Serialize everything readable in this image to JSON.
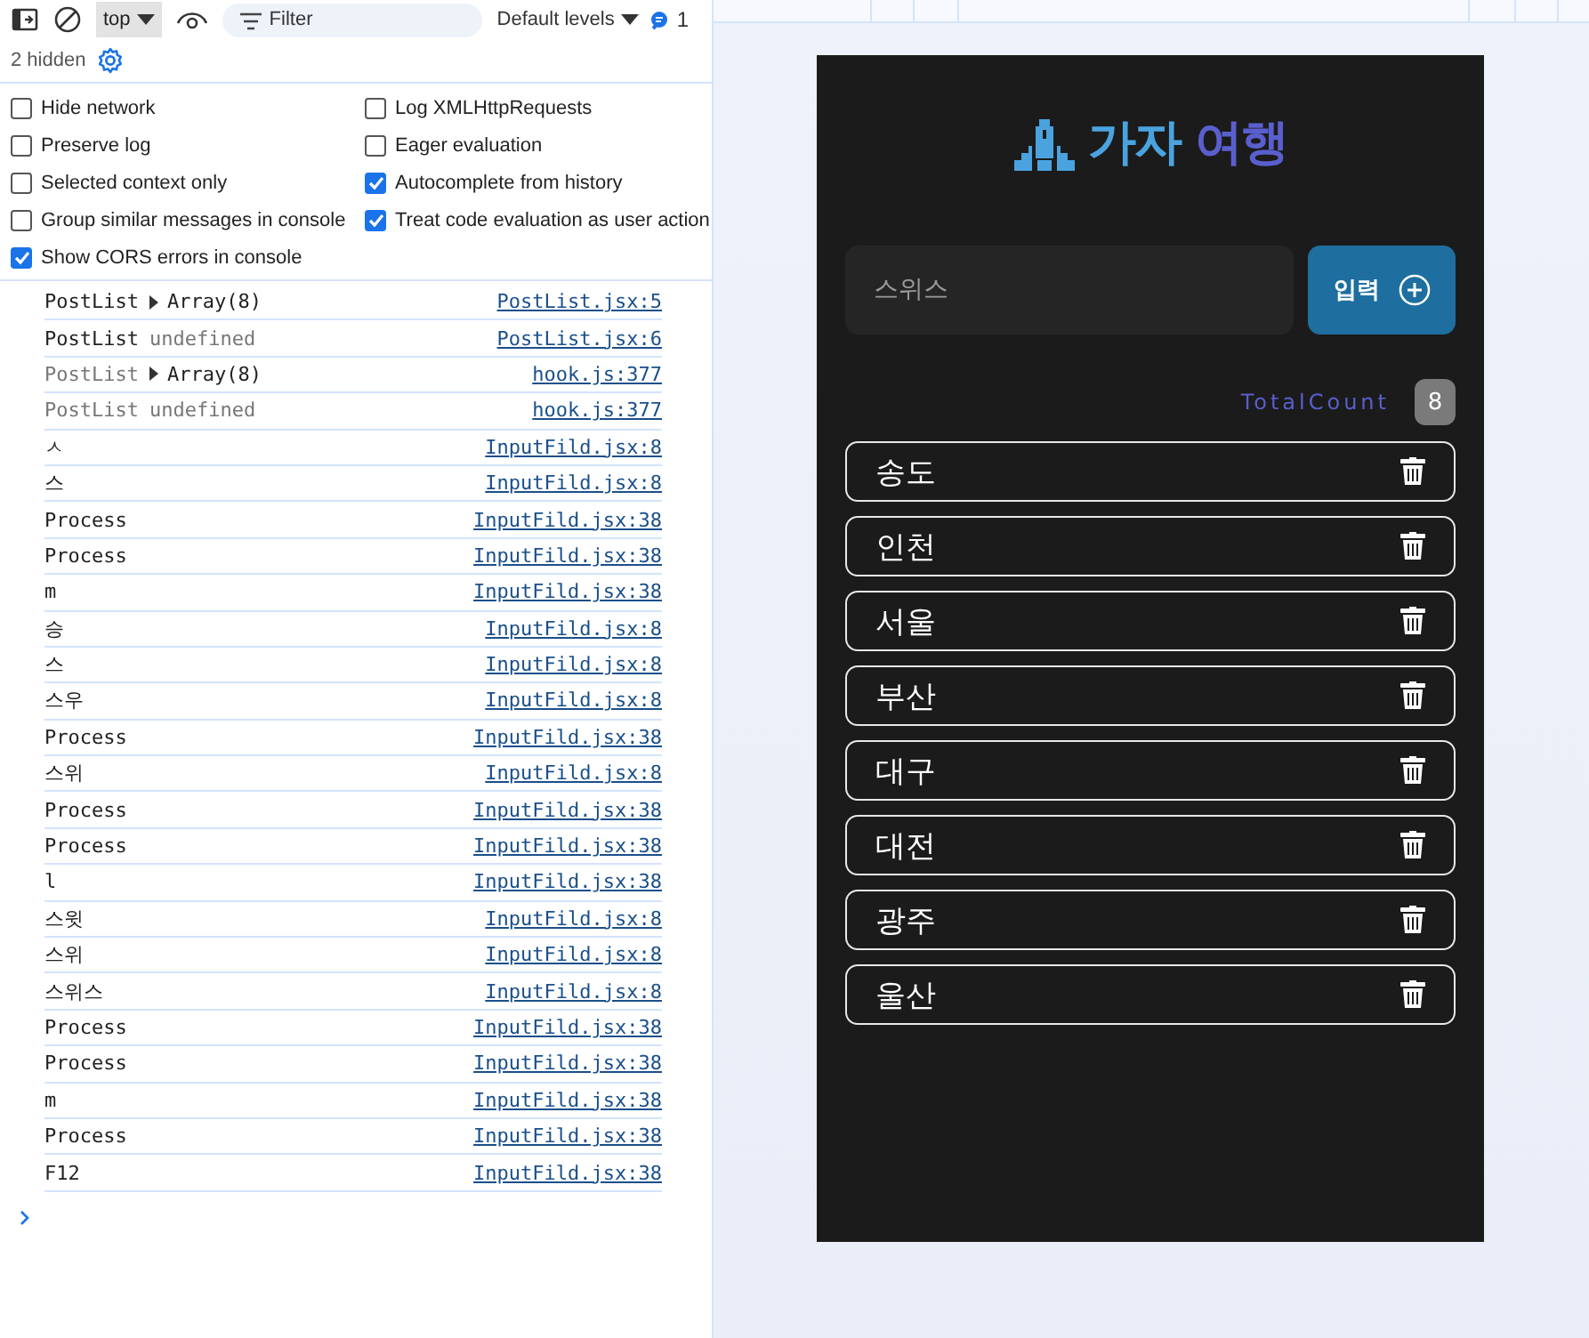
{
  "toolbar": {
    "context": "top",
    "filter_placeholder": "Filter",
    "levels": "Default levels",
    "issues_count": "1",
    "hidden": "2 hidden"
  },
  "settings": [
    {
      "label": "Hide network",
      "checked": false
    },
    {
      "label": "Log XMLHttpRequests",
      "checked": false
    },
    {
      "label": "Preserve log",
      "checked": false
    },
    {
      "label": "Eager evaluation",
      "checked": false
    },
    {
      "label": "Selected context only",
      "checked": false
    },
    {
      "label": "Autocomplete from history",
      "checked": true
    },
    {
      "label": "Group similar messages in console",
      "checked": false
    },
    {
      "label": "Treat code evaluation as user action",
      "checked": true
    },
    {
      "label": "Show CORS errors in console",
      "checked": true
    }
  ],
  "console": [
    {
      "text": "PostList",
      "value": {
        "kind": "object",
        "text": "Array(8)"
      },
      "dimmed": false,
      "source": "PostList.jsx:5"
    },
    {
      "text": "PostList",
      "value": {
        "kind": "undefined",
        "text": "undefined"
      },
      "dimmed": false,
      "source": "PostList.jsx:6"
    },
    {
      "text": "PostList",
      "value": {
        "kind": "object",
        "text": "Array(8)"
      },
      "dimmed": true,
      "source": "hook.js:377"
    },
    {
      "text": "PostList",
      "value": {
        "kind": "undefined",
        "text": "undefined"
      },
      "dimmed": true,
      "source": "hook.js:377"
    },
    {
      "text": "ㅅ",
      "dimmed": false,
      "source": "InputFild.jsx:8"
    },
    {
      "text": "스",
      "dimmed": false,
      "source": "InputFild.jsx:8"
    },
    {
      "text": "Process",
      "dimmed": false,
      "source": "InputFild.jsx:38"
    },
    {
      "text": "Process",
      "dimmed": false,
      "source": "InputFild.jsx:38"
    },
    {
      "text": "m",
      "dimmed": false,
      "source": "InputFild.jsx:38"
    },
    {
      "text": "승",
      "dimmed": false,
      "source": "InputFild.jsx:8"
    },
    {
      "text": "스",
      "dimmed": false,
      "source": "InputFild.jsx:8"
    },
    {
      "text": "스우",
      "dimmed": false,
      "source": "InputFild.jsx:8"
    },
    {
      "text": "Process",
      "dimmed": false,
      "source": "InputFild.jsx:38"
    },
    {
      "text": "스위",
      "dimmed": false,
      "source": "InputFild.jsx:8"
    },
    {
      "text": "Process",
      "dimmed": false,
      "source": "InputFild.jsx:38"
    },
    {
      "text": "Process",
      "dimmed": false,
      "source": "InputFild.jsx:38"
    },
    {
      "text": "l",
      "dimmed": false,
      "source": "InputFild.jsx:38"
    },
    {
      "text": "스윗",
      "dimmed": false,
      "source": "InputFild.jsx:8"
    },
    {
      "text": "스위",
      "dimmed": false,
      "source": "InputFild.jsx:8"
    },
    {
      "text": "스위스",
      "dimmed": false,
      "source": "InputFild.jsx:8"
    },
    {
      "text": "Process",
      "dimmed": false,
      "source": "InputFild.jsx:38"
    },
    {
      "text": "Process",
      "dimmed": false,
      "source": "InputFild.jsx:38"
    },
    {
      "text": "m",
      "dimmed": false,
      "source": "InputFild.jsx:38"
    },
    {
      "text": "Process",
      "dimmed": false,
      "source": "InputFild.jsx:38"
    },
    {
      "text": "F12",
      "dimmed": false,
      "source": "InputFild.jsx:38"
    }
  ],
  "app": {
    "title_parts": [
      "가자",
      "여행"
    ],
    "input_value": "스위스",
    "submit": "입력",
    "total_label": "TotalCount",
    "total_count": "8",
    "items": [
      "송도",
      "인천",
      "서울",
      "부산",
      "대구",
      "대전",
      "광주",
      "울산"
    ]
  }
}
